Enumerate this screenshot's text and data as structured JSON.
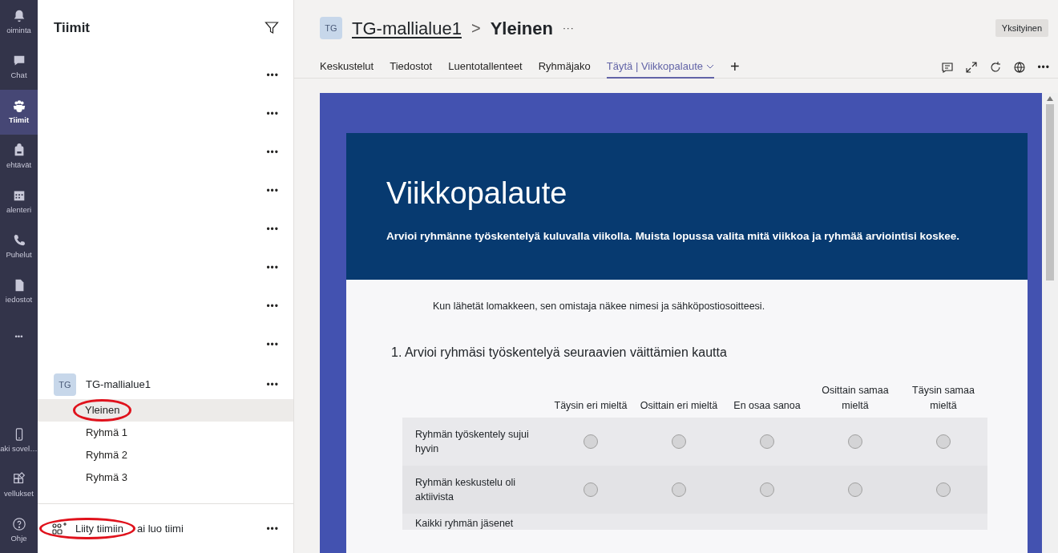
{
  "rail": {
    "items": [
      {
        "label": "oiminta",
        "selected": false
      },
      {
        "label": "Chat",
        "selected": false
      },
      {
        "label": "Tiimit",
        "selected": true
      },
      {
        "label": "ehtävät",
        "selected": false
      },
      {
        "label": "alenteri",
        "selected": false
      },
      {
        "label": "Puhelut",
        "selected": false
      },
      {
        "label": "iedostot",
        "selected": false
      },
      {
        "label": "•••",
        "selected": false
      }
    ],
    "bottom_items": [
      {
        "label": "aki sovel…"
      },
      {
        "label": "vellukset"
      },
      {
        "label": "Ohje"
      }
    ]
  },
  "teams_panel": {
    "title": "Tiimit",
    "teams": [
      {
        "more": "•••"
      },
      {
        "more": "•••"
      },
      {
        "more": "•••"
      },
      {
        "more": "•••"
      },
      {
        "more": "•••"
      },
      {
        "more": "•••"
      },
      {
        "more": "•••"
      },
      {
        "more": "•••"
      }
    ],
    "team": {
      "initials": "TG",
      "name": "TG-mallialue1",
      "more": "•••",
      "channels": [
        {
          "name": "Yleinen",
          "selected": true,
          "circled": true
        },
        {
          "name": "Ryhmä 1",
          "selected": false,
          "circled": false
        },
        {
          "name": "Ryhmä 2",
          "selected": false,
          "circled": false
        },
        {
          "name": "Ryhmä 3",
          "selected": false,
          "circled": false
        }
      ]
    },
    "join": {
      "parts": [
        "Liity tiimiin",
        "ai luo tiimi"
      ],
      "circled": true,
      "more": "•••"
    }
  },
  "header": {
    "initials": "TG",
    "team": "TG-mallialue1",
    "separator": ">",
    "channel": "Yleinen",
    "more": "···",
    "privacy": "Yksityinen"
  },
  "tabs": [
    {
      "label": "Keskustelut",
      "selected": false
    },
    {
      "label": "Tiedostot",
      "selected": false
    },
    {
      "label": "Luentotallenteet",
      "selected": false
    },
    {
      "label": "Ryhmäjako",
      "selected": false
    },
    {
      "label": "Täytä | Viikkopalaute",
      "selected": true
    }
  ],
  "add_tab": "+",
  "tools_more": "•••",
  "form": {
    "title": "Viikkopalaute",
    "description": "Arvioi ryhmänne työskentelyä kuluvalla viikolla. Muista lopussa valita mitä viikkoa ja ryhmää arviointisi koskee.",
    "notice": "Kun lähetät lomakkeen, sen omistaja näkee nimesi ja sähköpostiosoitteesi.",
    "question": "1. Arvioi ryhmäsi työskentelyä seuraavien väittämien kautta",
    "columns": [
      "Täysin eri mieltä",
      "Osittain eri mieltä",
      "En osaa sanoa",
      "Osittain samaa mieltä",
      "Täysin samaa mieltä"
    ],
    "rows": [
      {
        "statement": "Ryhmän työskentely sujui hyvin",
        "choices": [
          {
            "selected": false
          },
          {
            "selected": false
          },
          {
            "selected": false
          },
          {
            "selected": false
          },
          {
            "selected": false
          }
        ]
      },
      {
        "statement": "Ryhmän keskustelu oli aktiivista",
        "choices": [
          {
            "selected": false
          },
          {
            "selected": false
          },
          {
            "selected": false
          },
          {
            "selected": false
          },
          {
            "selected": false
          }
        ]
      },
      {
        "statement": "Kaikki ryhmän jäsenet"
      }
    ]
  }
}
